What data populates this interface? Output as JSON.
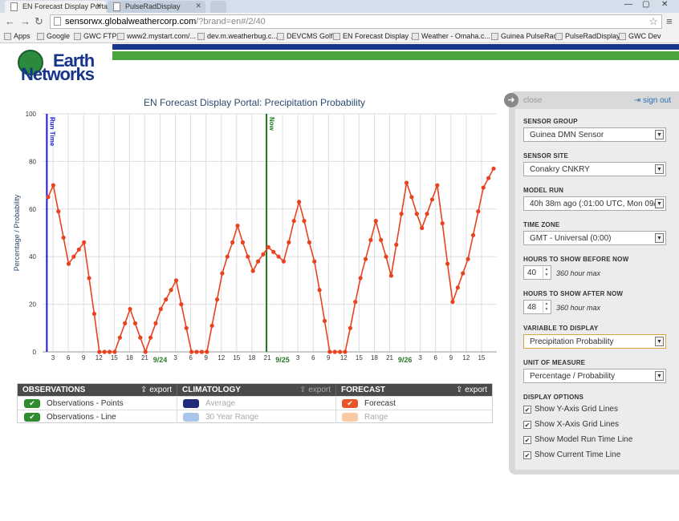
{
  "browser": {
    "tabs": [
      {
        "label": "EN Forecast Display Portal",
        "active": true
      },
      {
        "label": "PulseRadDisplay",
        "active": false
      }
    ],
    "url_host": "sensorwx.globalweathercorp.com",
    "url_rest": "/?brand=en#/2/40",
    "bookmarks": [
      "Apps",
      "Google",
      "GWC FTP",
      "www2.mystart.com/...",
      "dev.m.weatherbug.c...",
      "DEVCMS Golf",
      "EN Forecast Display ...",
      "Weather - Omaha.c...",
      "Guinea PulseRad",
      "PulseRadDisplay",
      "GWC Dev"
    ]
  },
  "logo": {
    "line1": "Earth",
    "line2": "Networks"
  },
  "chart_data": {
    "type": "line",
    "title": "EN Forecast Display Portal: Precipitation Probability",
    "ylabel": "Percentage / Probability",
    "ylim": [
      0,
      100
    ],
    "yticks": [
      0,
      20,
      40,
      60,
      80,
      100
    ],
    "x_hour_labels": [
      "3",
      "6",
      "9",
      "12",
      "15",
      "18",
      "21",
      "",
      "3",
      "6",
      "9",
      "12",
      "15",
      "18",
      "21",
      "",
      "3",
      "6",
      "9",
      "12",
      "15",
      "18",
      "21",
      "",
      "3",
      "6",
      "9",
      "12",
      "15"
    ],
    "date_labels": [
      {
        "text": "9/24",
        "slot": 7
      },
      {
        "text": "9/25",
        "slot": 15
      },
      {
        "text": "9/26",
        "slot": 23
      }
    ],
    "run_time_label": "Run Time",
    "now_label": "Now",
    "run_time_slot": -0.4,
    "now_slot": 13.95,
    "series": [
      {
        "name": "Forecast",
        "color": "#e8421f",
        "values": [
          65,
          70,
          59,
          48,
          37,
          40,
          43,
          46,
          31,
          16,
          0,
          0,
          0,
          0,
          6,
          12,
          18,
          12,
          6,
          0,
          6,
          12,
          18,
          22,
          26,
          30,
          20,
          10,
          0,
          0,
          0,
          0,
          11,
          22,
          33,
          40,
          46,
          53,
          46,
          40,
          34,
          38,
          41,
          44,
          42,
          40,
          38,
          46,
          55,
          63,
          55,
          46,
          38,
          26,
          13,
          0,
          0,
          0,
          0,
          10,
          21,
          31,
          39,
          47,
          55,
          47,
          40,
          32,
          45,
          58,
          71,
          65,
          58,
          52,
          58,
          64,
          70,
          54,
          37,
          21,
          27,
          33,
          39,
          49,
          59,
          69,
          73,
          77
        ]
      }
    ]
  },
  "legend": {
    "observations": {
      "header": "OBSERVATIONS",
      "export": "export",
      "items": [
        "Observations - Points",
        "Observations - Line"
      ]
    },
    "climatology": {
      "header": "CLIMATOLOGY",
      "export": "export",
      "items": [
        "Average",
        "30 Year Range"
      ]
    },
    "forecast": {
      "header": "FORECAST",
      "export": "export",
      "items": [
        "Forecast",
        "Range"
      ]
    },
    "colors": {
      "obs": "#2e8b2e",
      "avg": "#1f2a78",
      "range30": "#a9c6ea",
      "forecast": "#e8532a",
      "frange": "#f9c9a4"
    }
  },
  "panel": {
    "close": "close",
    "signout": "sign out",
    "sensor_group": {
      "label": "SENSOR GROUP",
      "value": "Guinea DMN Sensor"
    },
    "sensor_site": {
      "label": "SENSOR SITE",
      "value": "Conakry CNKRY"
    },
    "model_run": {
      "label": "MODEL RUN",
      "value": "40h 38m ago (:01:00 UTC, Mon 09/2"
    },
    "time_zone": {
      "label": "TIME ZONE",
      "value": "GMT - Universal (0:00)"
    },
    "hours_before": {
      "label": "HOURS TO SHOW BEFORE NOW",
      "value": "40",
      "hint": "360 hour max"
    },
    "hours_after": {
      "label": "HOURS TO SHOW AFTER NOW",
      "value": "48",
      "hint": "360 hour max"
    },
    "variable": {
      "label": "VARIABLE TO DISPLAY",
      "value": "Precipitation Probability"
    },
    "unit": {
      "label": "UNIT OF MEASURE",
      "value": "Percentage / Probability"
    },
    "display_options": {
      "label": "DISPLAY OPTIONS",
      "items": [
        "Show Y-Axis Grid Lines",
        "Show X-Axis Grid Lines",
        "Show Model Run Time Line",
        "Show Current Time Line"
      ]
    }
  }
}
